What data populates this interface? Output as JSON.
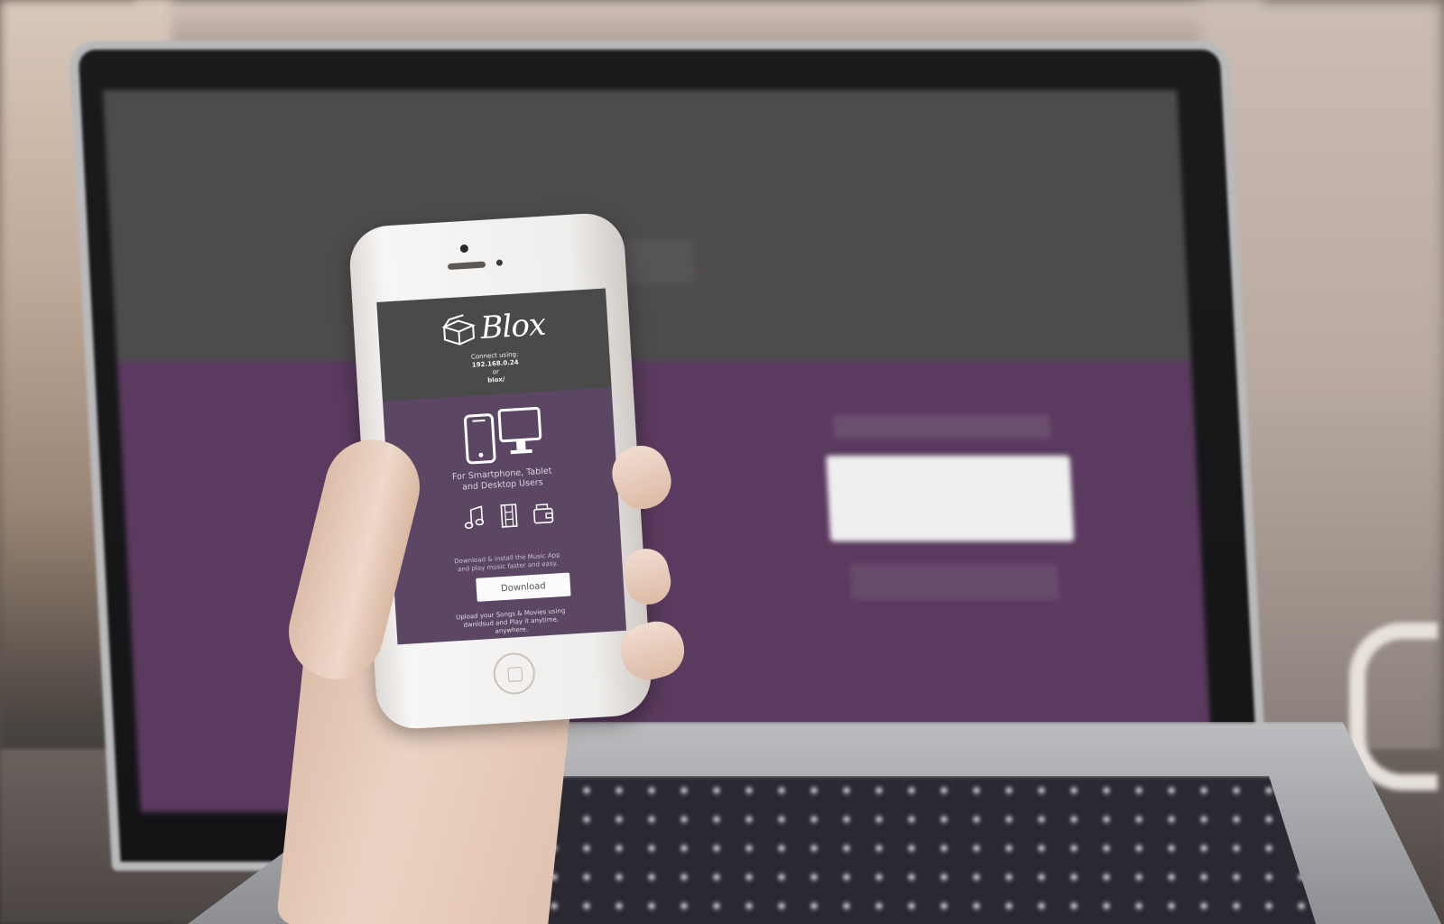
{
  "app": {
    "name": "Blox",
    "connect_label": "Connect using:",
    "connect_ip": "192.168.0.24",
    "connect_or": "or",
    "connect_host": "blox/"
  },
  "features": {
    "tagline_line1": "For Smartphone, Tablet",
    "tagline_line2": "and Desktop Users",
    "icons": [
      "smartphone-icon",
      "desktop-monitor-icon",
      "music-note-icon",
      "film-strip-icon",
      "wallet-icon"
    ]
  },
  "download": {
    "desc_line1": "Download & install the Music App",
    "desc_line2": "and play music faster and easy.",
    "button_label": "Download"
  },
  "upload": {
    "line1": "Upload your Songs & Movies using",
    "line2": "dwnldsud and Play it anytime,",
    "line3": "anywhere."
  },
  "colors": {
    "header_bg": "#4a4a4a",
    "body_bg": "#5b4664",
    "button_bg": "#fbfbfb"
  }
}
